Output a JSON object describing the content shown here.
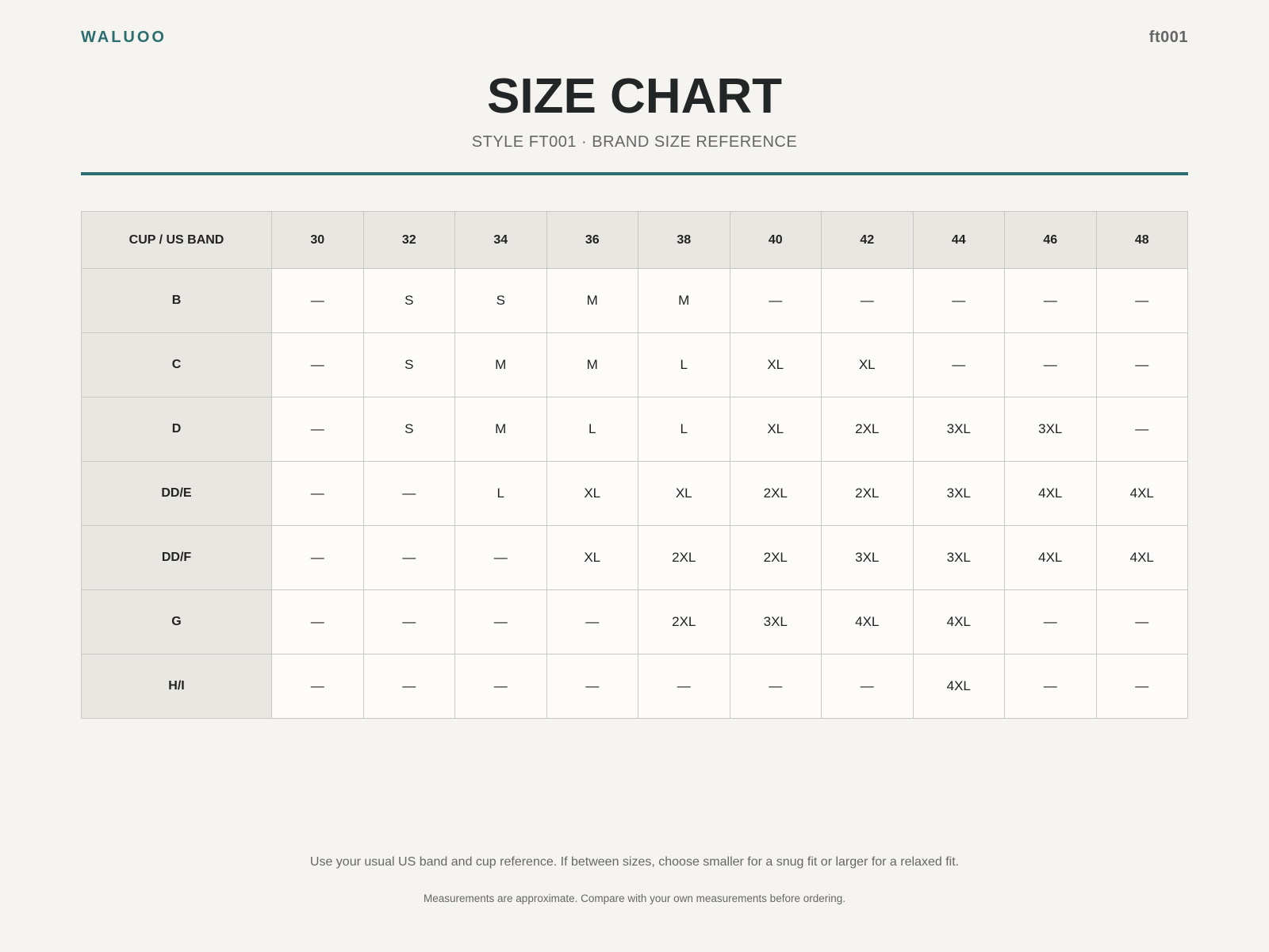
{
  "header": {
    "brand": "WALUOO",
    "code": "ft001"
  },
  "title": "SIZE CHART",
  "subtitle": "STYLE FT001 · BRAND SIZE REFERENCE",
  "table": {
    "corner_label": "CUP / US BAND",
    "bands": [
      "30",
      "32",
      "34",
      "36",
      "38",
      "40",
      "42",
      "44",
      "46",
      "48"
    ],
    "rows": [
      {
        "cup": "B",
        "sizes": [
          "—",
          "S",
          "S",
          "M",
          "M",
          "—",
          "—",
          "—",
          "—",
          "—"
        ]
      },
      {
        "cup": "C",
        "sizes": [
          "—",
          "S",
          "M",
          "M",
          "L",
          "XL",
          "XL",
          "—",
          "—",
          "—"
        ]
      },
      {
        "cup": "D",
        "sizes": [
          "—",
          "S",
          "M",
          "L",
          "L",
          "XL",
          "2XL",
          "3XL",
          "3XL",
          "—"
        ]
      },
      {
        "cup": "DD/E",
        "sizes": [
          "—",
          "—",
          "L",
          "XL",
          "XL",
          "2XL",
          "2XL",
          "3XL",
          "4XL",
          "4XL"
        ]
      },
      {
        "cup": "DD/F",
        "sizes": [
          "—",
          "—",
          "—",
          "XL",
          "2XL",
          "2XL",
          "3XL",
          "3XL",
          "4XL",
          "4XL"
        ]
      },
      {
        "cup": "G",
        "sizes": [
          "—",
          "—",
          "—",
          "—",
          "2XL",
          "3XL",
          "4XL",
          "4XL",
          "—",
          "—"
        ]
      },
      {
        "cup": "H/I",
        "sizes": [
          "—",
          "—",
          "—",
          "—",
          "—",
          "—",
          "—",
          "4XL",
          "—",
          "—"
        ]
      }
    ]
  },
  "footer": {
    "note": "Use your usual US band and cup reference. If between sizes, choose smaller for a snug fit or larger for a relaxed fit.",
    "fine_print": "Measurements are approximate. Compare with your own measurements before ordering."
  }
}
